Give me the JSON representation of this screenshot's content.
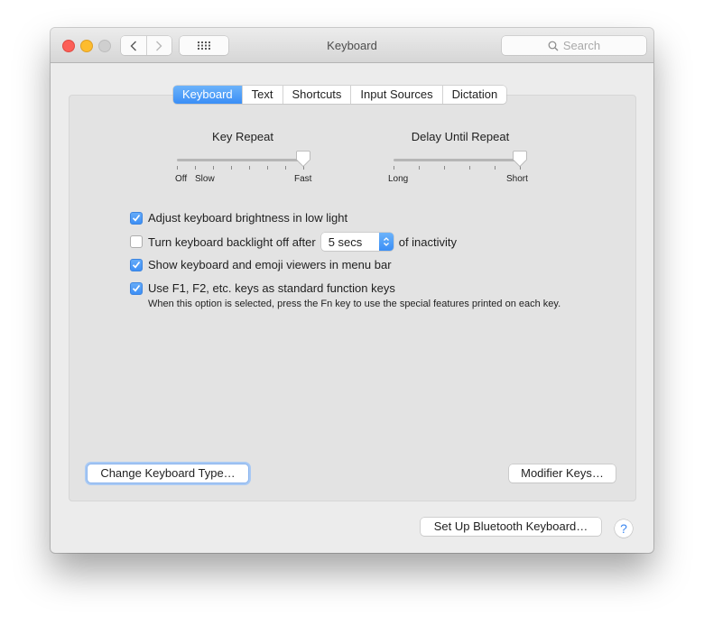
{
  "window": {
    "title": "Keyboard",
    "search_placeholder": "Search"
  },
  "tabs": [
    {
      "label": "Keyboard",
      "active": true
    },
    {
      "label": "Text",
      "active": false
    },
    {
      "label": "Shortcuts",
      "active": false
    },
    {
      "label": "Input Sources",
      "active": false
    },
    {
      "label": "Dictation",
      "active": false
    }
  ],
  "sliders": {
    "key_repeat": {
      "title": "Key Repeat",
      "labels": {
        "off": "Off",
        "slow": "Slow",
        "fast": "Fast"
      },
      "ticks": 8,
      "position": 8
    },
    "delay_until_repeat": {
      "title": "Delay Until Repeat",
      "labels": {
        "long": "Long",
        "short": "Short"
      },
      "ticks": 6,
      "position": 6
    }
  },
  "options": {
    "brightness": {
      "label": "Adjust keyboard brightness in low light",
      "checked": true
    },
    "backlight": {
      "label": "Turn keyboard backlight off after",
      "checked": false,
      "select_value": "5 secs",
      "suffix": "of inactivity"
    },
    "viewers": {
      "label": "Show keyboard and emoji viewers in menu bar",
      "checked": true
    },
    "fn_keys": {
      "label": "Use F1, F2, etc. keys as standard function keys",
      "checked": true,
      "help": "When this option is selected, press the Fn key to use the special features printed on each key."
    }
  },
  "buttons": {
    "change_type": "Change Keyboard Type…",
    "modifier_keys": "Modifier Keys…",
    "bluetooth": "Set Up Bluetooth Keyboard…",
    "help": "?"
  },
  "colors": {
    "accent": "#3a8ef6",
    "close": "#fc5f57",
    "minimize": "#fdbc2e",
    "zoom_disabled": "#cfcfcf"
  }
}
